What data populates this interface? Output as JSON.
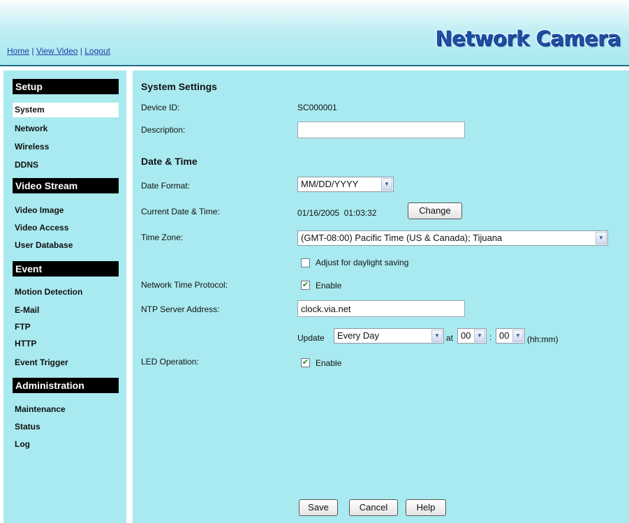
{
  "header": {
    "links": [
      "Home",
      "View Video",
      "Logout"
    ],
    "separator": "|",
    "logo": "Network Camera"
  },
  "sidebar": {
    "sections": [
      {
        "title": "Setup",
        "items": [
          "System",
          "Network",
          "Wireless",
          "DDNS"
        ]
      },
      {
        "title": "Video Stream",
        "items": [
          "Video Image",
          "Video Access",
          "User Database"
        ]
      },
      {
        "title": "Event",
        "items": [
          "Motion Detection",
          "E-Mail",
          "FTP",
          "HTTP",
          "Event Trigger"
        ]
      },
      {
        "title": "Administration",
        "items": [
          "Maintenance",
          "Status",
          "Log"
        ]
      }
    ],
    "active_item": "System"
  },
  "system_settings": {
    "heading": "System Settings",
    "device_id_label": "Device ID:",
    "device_id_value": "SC000001",
    "description_label": "Description:",
    "description_value": ""
  },
  "date_time": {
    "heading": "Date & Time",
    "date_format_label": "Date Format:",
    "date_format_value": "MM/DD/YYYY",
    "current_label": "Current Date & Time:",
    "current_value": "01/16/2005  01:03:32",
    "change_button": "Change",
    "time_zone_label": "Time Zone:",
    "time_zone_value": "(GMT-08:00) Pacific Time (US & Canada); Tijuana",
    "daylight_label": "Adjust for daylight saving",
    "daylight_checked": false,
    "ntp_label": "Network Time Protocol:",
    "ntp_enable_label": "Enable",
    "ntp_enabled": true,
    "ntp_server_label": "NTP Server Address:",
    "ntp_server_value": "clock.via.net",
    "update_label": "Update",
    "update_value": "Every Day",
    "at_label": "at",
    "hour_value": "00",
    "colon": ":",
    "minute_value": "00",
    "time_hint": "(hh:mm)",
    "led_label": "LED Operation:",
    "led_enable_label": "Enable",
    "led_enabled": true
  },
  "buttons": {
    "save": "Save",
    "cancel": "Cancel",
    "help": "Help"
  },
  "colors": {
    "panel": "#a9eaf0",
    "link": "#1c3ea6",
    "section_head": "#000000",
    "logo": "#1d4fa8"
  }
}
